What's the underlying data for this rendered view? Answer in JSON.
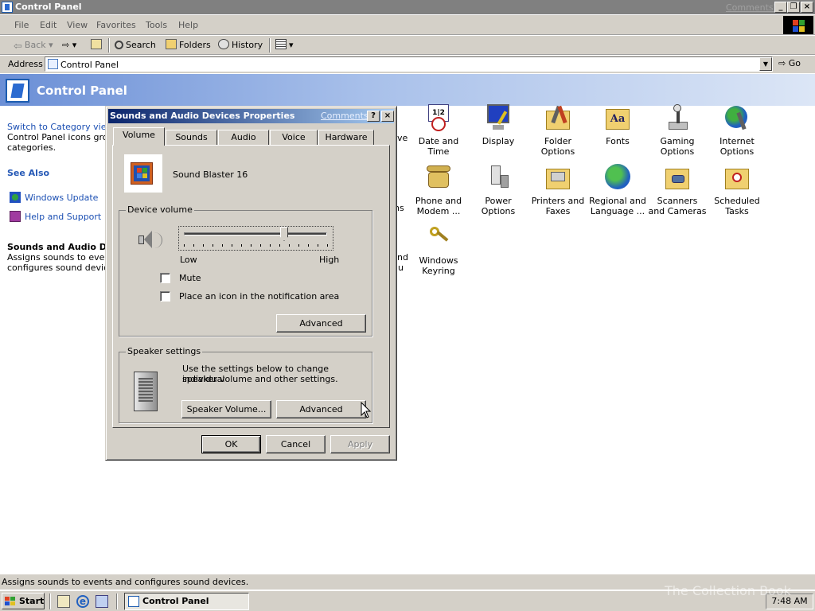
{
  "window": {
    "title": "Control Panel",
    "comments_link": "Comments?"
  },
  "menu": [
    "File",
    "Edit",
    "View",
    "Favorites",
    "Tools",
    "Help"
  ],
  "toolbar": {
    "back": "Back",
    "search": "Search",
    "folders": "Folders",
    "history": "History"
  },
  "address": {
    "label": "Address",
    "value": "Control Panel",
    "go": "Go"
  },
  "header": {
    "title": "Control Panel"
  },
  "left_pane": {
    "switch_link": "Switch to Category view",
    "switch_text_1": "Control Panel icons group",
    "switch_text_2": "categories.",
    "see_also": "See Also",
    "windows_update": "Windows Update",
    "help_support": "Help and Support",
    "detail_title": "Sounds and Audio Dev",
    "detail_line1": "Assigns sounds to events",
    "detail_line2": "configures sound devices"
  },
  "icons": {
    "row1": [
      "Date and Time",
      "Display",
      "Folder Options",
      "Fonts",
      "Gaming Options",
      "Internet Options"
    ],
    "row2": [
      "Phone and Modem ...",
      "Power Options",
      "Printers and Faxes",
      "Regional and Language ...",
      "Scanners and Cameras",
      "Scheduled Tasks"
    ],
    "row3": [
      "Windows Keyring"
    ],
    "partial": [
      "ve",
      "ns",
      "nd",
      "u"
    ]
  },
  "dialog": {
    "title": "Sounds and Audio Devices Properties",
    "comments_link": "Comments?",
    "help_btn": "?",
    "close_btn": "×",
    "tabs": [
      "Volume",
      "Sounds",
      "Audio",
      "Voice",
      "Hardware"
    ],
    "device_name": "Sound Blaster 16",
    "device_volume": {
      "label": "Device volume",
      "low": "Low",
      "high": "High",
      "level": 0.7
    },
    "mute_label": "Mute",
    "mute_checked": false,
    "notify_label": "Place an icon in the notification area",
    "notify_checked": false,
    "advanced_1": "Advanced",
    "speaker": {
      "label": "Speaker settings",
      "text_line1": "Use the settings below to change individual",
      "text_line2": "speaker volume and other settings.",
      "speaker_volume_btn": "Speaker Volume...",
      "advanced_btn": "Advanced"
    },
    "ok": "OK",
    "cancel": "Cancel",
    "apply": "Apply"
  },
  "status_bar": {
    "text": "Assigns sounds to events and configures sound devices."
  },
  "taskbar": {
    "start": "Start",
    "task_item": "Control Panel",
    "clock": "7:48 AM",
    "watermark": "The Collection Book"
  }
}
